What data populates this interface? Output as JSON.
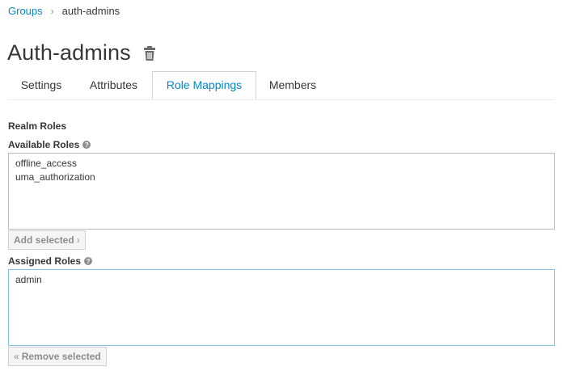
{
  "breadcrumb": {
    "parent": "Groups",
    "separator": "›",
    "current": "auth-admins"
  },
  "page": {
    "title": "Auth-admins"
  },
  "tabs": [
    {
      "label": "Settings",
      "active": false
    },
    {
      "label": "Attributes",
      "active": false
    },
    {
      "label": "Role Mappings",
      "active": true
    },
    {
      "label": "Members",
      "active": false
    }
  ],
  "realm_roles": {
    "section_title": "Realm Roles",
    "available": {
      "label": "Available Roles",
      "help": "?",
      "items": [
        "offline_access",
        "uma_authorization"
      ]
    },
    "add_button": {
      "label": "Add selected",
      "icon": "chevron-right-icon",
      "glyph": "›"
    },
    "assigned": {
      "label": "Assigned Roles",
      "help": "?",
      "items": [
        "admin"
      ]
    },
    "remove_button": {
      "label": "Remove selected",
      "icon": "double-chevron-left-icon",
      "glyph": "«"
    }
  },
  "colors": {
    "link": "#0088ce",
    "text": "#363636",
    "muted": "#8b8d8f",
    "focus_border": "#7dc3e8"
  }
}
